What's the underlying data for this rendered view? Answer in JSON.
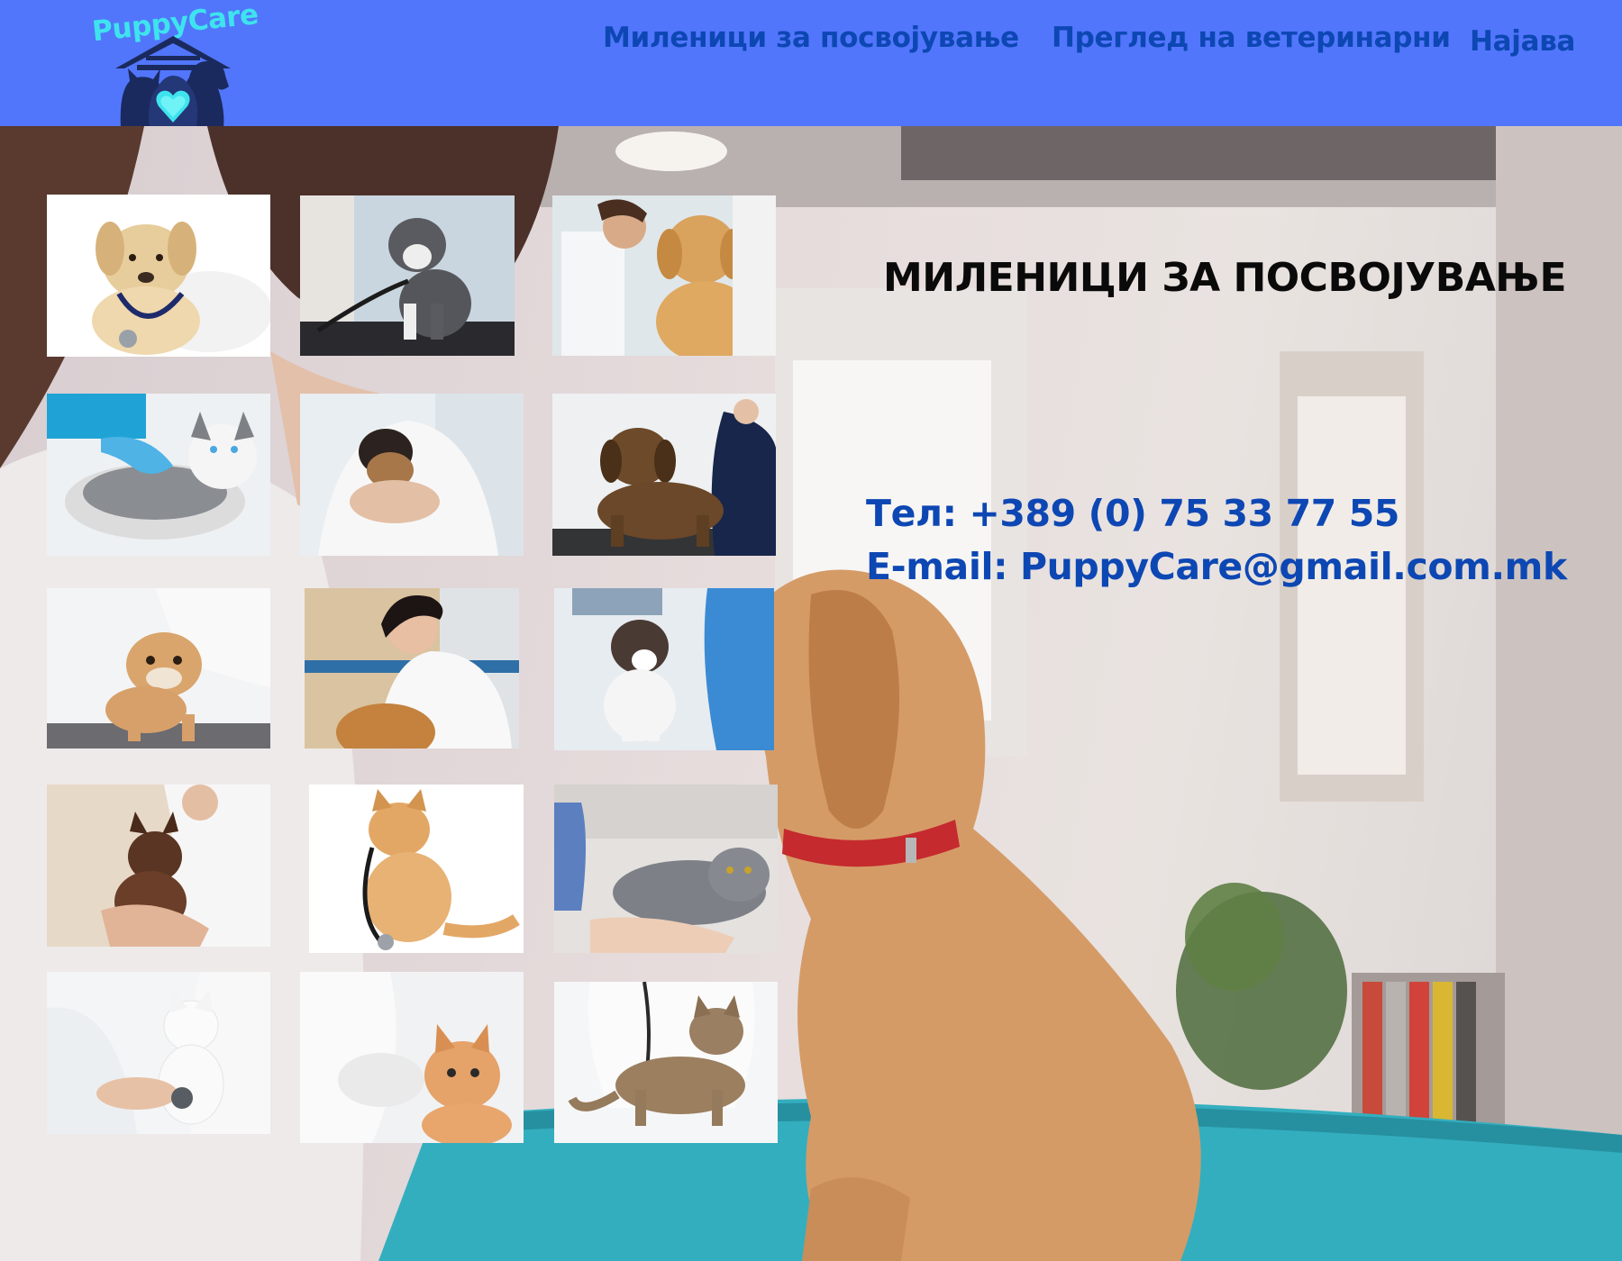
{
  "brand": {
    "logo_text": "PuppyCare"
  },
  "nav": {
    "items": [
      {
        "label": "Миленици за посвојување"
      },
      {
        "label": "Преглед на ветеринарни"
      },
      {
        "label": "Најава"
      }
    ]
  },
  "main": {
    "title": "МИЛЕНИЦИ ЗА ПОСВОЈУВАЊЕ",
    "phone": "Тел: +389 (0) 75 33 77 55",
    "email": "E-mail: PuppyCare@gmail.com.mk"
  },
  "colors": {
    "header_bg": "#5176fb",
    "nav_text": "#0d47b3",
    "logo_text": "#3ee3ee",
    "title_text": "#0a0a0a",
    "contact_text": "#0d47b3"
  },
  "gallery": [
    {
      "subject": "labrador-puppy-stethoscope"
    },
    {
      "subject": "grey-pitbull-puppy"
    },
    {
      "subject": "golden-retriever-puppy-vet"
    },
    {
      "subject": "husky-puppy-vet"
    },
    {
      "subject": "yorkie-puppy-vet"
    },
    {
      "subject": "brown-puppy-vet"
    },
    {
      "subject": "bulldog-puppy-vet"
    },
    {
      "subject": "vet-with-golden-retriever"
    },
    {
      "subject": "border-collie-puppy-vet"
    },
    {
      "subject": "chihuahua-puppy-vet"
    },
    {
      "subject": "ginger-cat-stethoscope"
    },
    {
      "subject": "grey-cat-vet"
    },
    {
      "subject": "white-kitten-vet"
    },
    {
      "subject": "ginger-kitten-vet"
    },
    {
      "subject": "tabby-cat-vet"
    }
  ]
}
